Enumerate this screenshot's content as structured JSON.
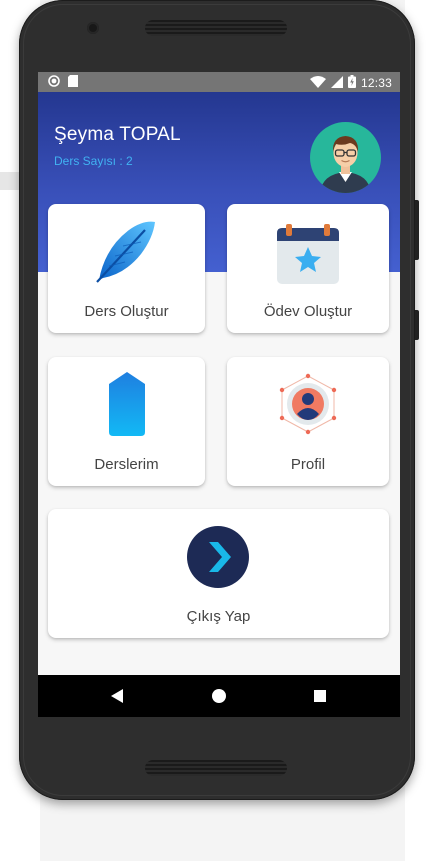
{
  "status_bar": {
    "time": "12:33",
    "icons": [
      "notification-circle-icon",
      "sd-card-icon",
      "wifi-icon",
      "signal-icon",
      "battery-icon"
    ]
  },
  "header": {
    "user_name": "Şeyma TOPAL",
    "course_count_label": "Ders Sayısı : 2",
    "avatar_icon": "user-avatar-icon"
  },
  "menu": [
    {
      "label": "Ders Oluştur",
      "icon": "feather-icon"
    },
    {
      "label": "Ödev Oluştur",
      "icon": "calendar-star-icon"
    },
    {
      "label": "Derslerim",
      "icon": "bookmark-tag-icon"
    },
    {
      "label": "Profil",
      "icon": "profile-network-icon"
    },
    {
      "label": "Çıkış Yap",
      "icon": "exit-arrow-icon"
    }
  ],
  "nav_bar": {
    "back_icon": "back-triangle-icon",
    "home_icon": "home-circle-icon",
    "recents_icon": "recents-square-icon"
  },
  "colors": {
    "header_top": "#243790",
    "header_bottom": "#4460d0",
    "accent": "#41b2f2",
    "avatar_bg": "#27b79b"
  }
}
